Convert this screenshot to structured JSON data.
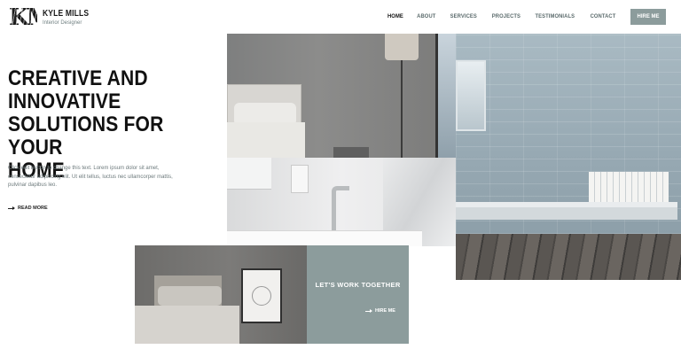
{
  "brand": {
    "monogram": "KM",
    "name": "KYLE MILLS",
    "tagline": "Interior Designer"
  },
  "nav": {
    "items": [
      "HOME",
      "ABOUT",
      "SERVICES",
      "PROJECTS",
      "TESTIMONIALS",
      "CONTACT"
    ],
    "active": "HOME",
    "cta_label": "HIRE ME"
  },
  "hero": {
    "title": "CREATIVE AND\nINNOVATIVE\nSOLUTIONS FOR YOUR\nHOME",
    "body": "Click edit button to change this text. Lorem ipsum dolor sit amet, consectetur adipiscing elit. Ut elit tellus, luctus nec ullamcorper mattis, pulvinar dapibus leo.",
    "read_more": "READ MORE"
  },
  "cta_box": {
    "title": "LET'S WORK TOGETHER",
    "link_label": "HIRE ME"
  },
  "colors": {
    "accent": "#8c9c9c",
    "text_dark": "#111111",
    "text_muted": "#6d7a7c"
  }
}
